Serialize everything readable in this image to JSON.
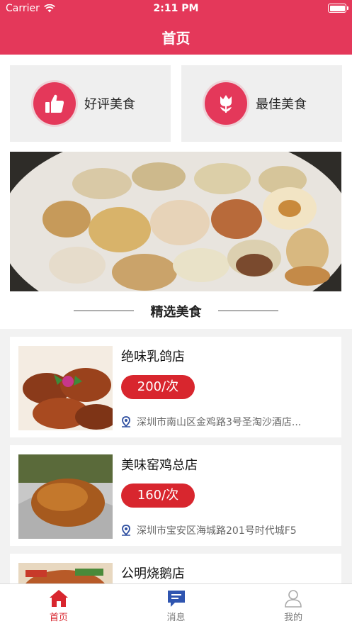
{
  "status_bar": {
    "carrier": "Carrier",
    "time": "2:11 PM"
  },
  "nav": {
    "title": "首页"
  },
  "cards": [
    {
      "label": "好评美食",
      "icon": "thumbs-up-icon"
    },
    {
      "label": "最佳美食",
      "icon": "tulip-icon"
    }
  ],
  "section": {
    "title": "精选美食"
  },
  "items": [
    {
      "name": "绝味乳鸽店",
      "price": "200/次",
      "address": "深圳市南山区金鸡路3号圣淘沙酒店..."
    },
    {
      "name": "美味窑鸡总店",
      "price": "160/次",
      "address": "深圳市宝安区海城路201号时代城F5"
    },
    {
      "name": "公明烧鹅店",
      "price": "",
      "address": ""
    }
  ],
  "tabs": [
    {
      "label": "首页",
      "icon": "home-icon",
      "active": true
    },
    {
      "label": "消息",
      "icon": "message-icon",
      "active": false
    },
    {
      "label": "我的",
      "icon": "user-icon",
      "active": false
    }
  ],
  "colors": {
    "brand": "#e4385a",
    "price": "#d8262e"
  }
}
